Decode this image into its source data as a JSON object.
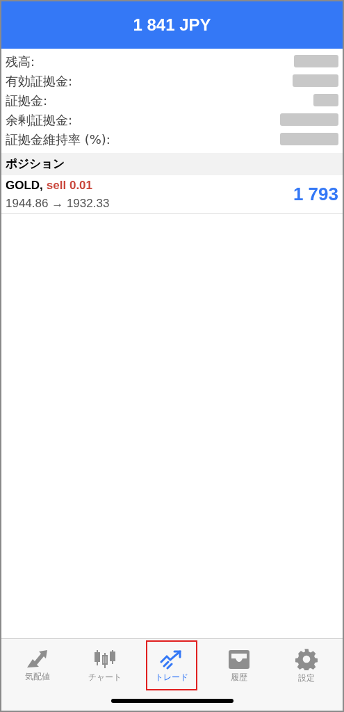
{
  "header": {
    "title": "1 841 JPY"
  },
  "account": [
    {
      "label": "残高:",
      "redacted": true
    },
    {
      "label": "有効証拠金:",
      "redacted": true
    },
    {
      "label": "証拠金:",
      "redacted": true
    },
    {
      "label": "余剰証拠金:",
      "redacted": true
    },
    {
      "label": "証拠金維持率 (%):",
      "redacted": true
    }
  ],
  "section": {
    "title": "ポジション"
  },
  "positions": [
    {
      "symbol": "GOLD,",
      "side": "sell 0.01",
      "prices": "1944.86 → 1932.33",
      "profit": "1 793"
    }
  ],
  "tabs": [
    {
      "label": "気配値",
      "kind": "quotes",
      "selected": false,
      "highlighted": false
    },
    {
      "label": "チャート",
      "kind": "chart",
      "selected": false,
      "highlighted": false
    },
    {
      "label": "トレード",
      "kind": "trade",
      "selected": true,
      "highlighted": true
    },
    {
      "label": "履歴",
      "kind": "history",
      "selected": false,
      "highlighted": false
    },
    {
      "label": "設定",
      "kind": "settings",
      "selected": false,
      "highlighted": false
    }
  ]
}
